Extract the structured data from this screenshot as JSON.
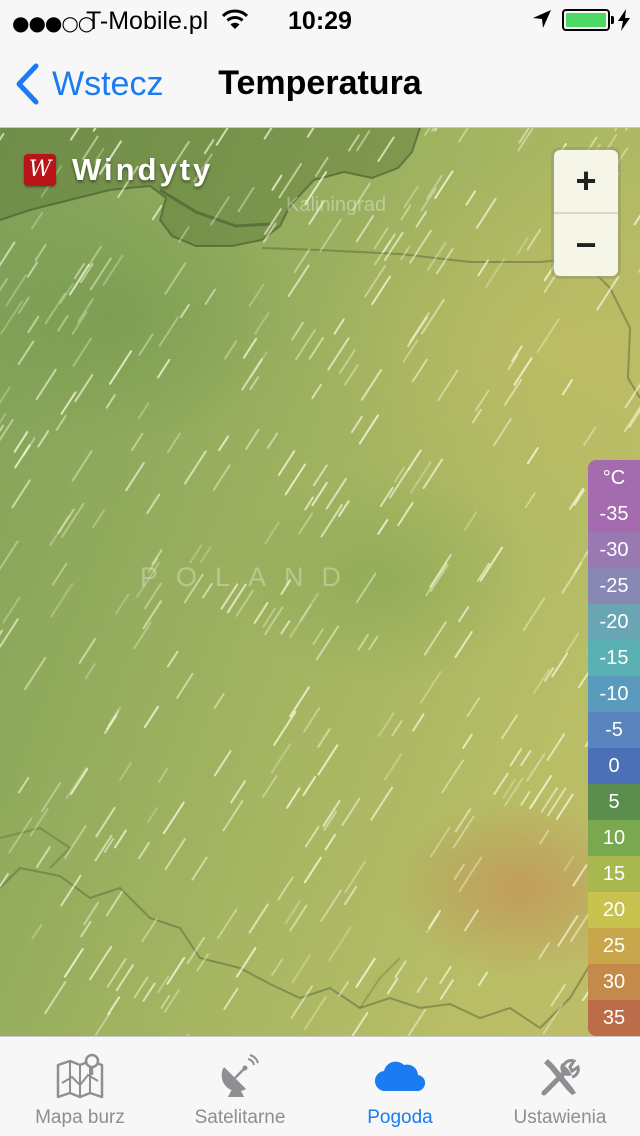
{
  "status_bar": {
    "signal": "●●●○○",
    "carrier": "T-Mobile.pl",
    "time": "10:29"
  },
  "nav": {
    "back_label": "Wstecz",
    "title": "Temperatura"
  },
  "map": {
    "brand": "Windyty",
    "city_label": "Kaliningrad",
    "country_label": "POLAND",
    "zoom_in": "+",
    "zoom_out": "−"
  },
  "legend": {
    "unit": "°C",
    "items": [
      {
        "label": "-35",
        "color": "#a46cae"
      },
      {
        "label": "-30",
        "color": "#9a79b3"
      },
      {
        "label": "-25",
        "color": "#8888b5"
      },
      {
        "label": "-20",
        "color": "#6aa5b4"
      },
      {
        "label": "-15",
        "color": "#5ab1b3"
      },
      {
        "label": "-10",
        "color": "#5a9bbd"
      },
      {
        "label": "-5",
        "color": "#5a84bd"
      },
      {
        "label": "0",
        "color": "#4d6fb6"
      },
      {
        "label": "5",
        "color": "#5b8d4f"
      },
      {
        "label": "10",
        "color": "#7aa84f"
      },
      {
        "label": "15",
        "color": "#a8b84e"
      },
      {
        "label": "20",
        "color": "#c8c24f"
      },
      {
        "label": "25",
        "color": "#c8a64b"
      },
      {
        "label": "30",
        "color": "#c48a49"
      },
      {
        "label": "35",
        "color": "#bc6c48"
      }
    ],
    "unit_color": "#a46cae"
  },
  "tabs": [
    {
      "label": "Mapa burz",
      "icon": "map-icon",
      "active": false
    },
    {
      "label": "Satelitarne",
      "icon": "satellite-dish-icon",
      "active": false
    },
    {
      "label": "Pogoda",
      "icon": "cloud-icon",
      "active": true
    },
    {
      "label": "Ustawienia",
      "icon": "tools-icon",
      "active": false
    }
  ],
  "colors": {
    "accent": "#1a7cf0",
    "battery": "#4cd964",
    "logo": "#b8141a"
  }
}
